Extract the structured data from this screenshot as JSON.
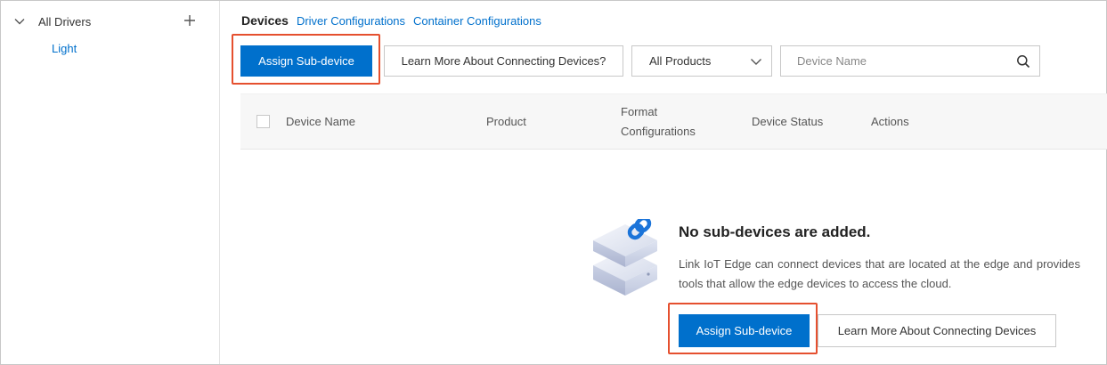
{
  "sidebar": {
    "root_label": "All Drivers",
    "items": [
      {
        "label": "Light"
      }
    ]
  },
  "tabs": [
    {
      "label": "Devices",
      "active": true
    },
    {
      "label": "Driver Configurations",
      "active": false
    },
    {
      "label": "Container Configurations",
      "active": false
    }
  ],
  "toolbar": {
    "assign_label": "Assign Sub-device",
    "learn_label": "Learn More About Connecting Devices?",
    "product_select": "All Products",
    "search_placeholder": "Device Name"
  },
  "table": {
    "columns": [
      "Device Name",
      "Product",
      "Format\nConfigurations",
      "Device Status",
      "Actions"
    ]
  },
  "empty_state": {
    "title": "No sub-devices are added.",
    "description": "Link IoT Edge can connect devices that are located at the edge and provides tools that allow the edge devices to access the cloud.",
    "assign_label": "Assign Sub-device",
    "learn_label": "Learn More About Connecting Devices"
  },
  "colors": {
    "primary": "#0070cc",
    "highlight": "#e5502f",
    "link": "#0070cc"
  },
  "icons": [
    "chevron-down-icon",
    "plus-icon",
    "search-icon",
    "cube-link-illustration"
  ]
}
